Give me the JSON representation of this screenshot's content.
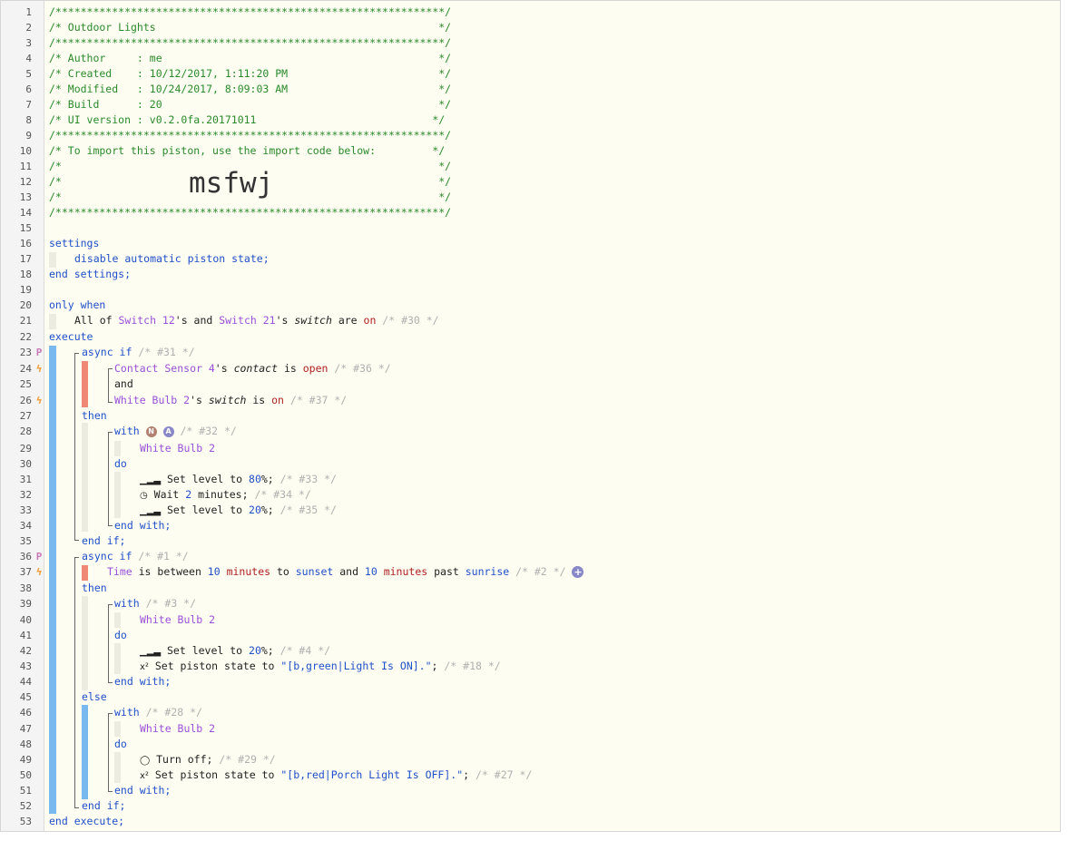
{
  "header": {
    "stars": "/**************************************************************/",
    "title": "/* Outdoor Lights                                             */",
    "author": "/* Author     : me                                            */",
    "created": "/* Created    : 10/12/2017, 1:11:20 PM                        */",
    "modified": "/* Modified   : 10/24/2017, 8:09:03 AM                        */",
    "build": "/* Build      : 20                                            */",
    "ui_version": "/* UI version : v0.2.0fa.20171011                            */",
    "import_line": "/* To import this piston, use the import code below:         */",
    "blank": "/*                                                            */",
    "import_code": "msfwj"
  },
  "settings": {
    "open": "settings",
    "line": "disable automatic piston state;",
    "close": "end settings;"
  },
  "only_when": {
    "label": "only when",
    "all_of": "All of ",
    "dev1": "Switch 12",
    "mid": "'s and ",
    "dev2": "Switch 21",
    "poss": "'s ",
    "attr": "switch",
    "are": " are ",
    "val": "on",
    "comment": " /* #30 */"
  },
  "execute": {
    "open": "execute",
    "close": "end execute;"
  },
  "if1": {
    "kw": "async if",
    "comment": " /* #31 */",
    "c1_dev": "Contact Sensor 4",
    "c1_poss": "'s ",
    "c1_attr": "contact",
    "c1_is": " is ",
    "c1_val": "open",
    "c1_comment": " /* #36 */",
    "and": "and",
    "c2_dev": "White Bulb 2",
    "c2_poss": "'s ",
    "c2_attr": "switch",
    "c2_is": " is ",
    "c2_val": "on",
    "c2_comment": " /* #37 */",
    "then": "then",
    "with": "with",
    "badge_n": "N",
    "badge_a": "A",
    "with_comment": " /* #32 */",
    "device": "White Bulb 2",
    "do": "do",
    "a1_pre": " Set level to ",
    "a1_val": "80",
    "a1_post": "%;",
    "a1_comment": " /* #33 */",
    "a2_pre": " Wait ",
    "a2_val": "2",
    "a2_post": " minutes;",
    "a2_comment": " /* #34 */",
    "a3_pre": " Set level to ",
    "a3_val": "20",
    "a3_post": "%;",
    "a3_comment": " /* #35 */",
    "end_with": "end with;",
    "end_if": "end if;"
  },
  "if2": {
    "kw": "async if",
    "comment": " /* #1 */",
    "c_time": "Time",
    "c_is": " is between ",
    "c_n1": "10",
    "c_min1": " minutes",
    "c_to": " to ",
    "c_sunset": "sunset",
    "c_and": " and ",
    "c_n2": "10",
    "c_min2": " minutes",
    "c_past": " past ",
    "c_sunrise": "sunrise",
    "c_comment": " /* #2 */",
    "then": "then",
    "with": "with",
    "with_comment": " /* #3 */",
    "device": "White Bulb 2",
    "do": "do",
    "a1_pre": " Set level to ",
    "a1_val": "20",
    "a1_post": "%;",
    "a1_comment": " /* #4 */",
    "a2_pre": " Set piston state to ",
    "a2_val": "\"[b,green|Light Is ON].\"",
    "a2_post": ";",
    "a2_comment": " /* #18 */",
    "end_with": "end with;",
    "else": "else",
    "with2": "with",
    "with2_comment": " /* #28 */",
    "device2": "White Bulb 2",
    "do2": "do",
    "b1": " Turn off;",
    "b1_comment": " /* #29 */",
    "b2_pre": " Set piston state to ",
    "b2_val": "\"[b,red|Porch Light Is OFF].\"",
    "b2_post": ";",
    "b2_comment": " /* #27 */",
    "end_with2": "end with;",
    "end_if": "end if;"
  },
  "line_numbers": [
    "1",
    "2",
    "3",
    "4",
    "5",
    "6",
    "7",
    "8",
    "9",
    "10",
    "11",
    "12",
    "13",
    "14",
    "15",
    "16",
    "17",
    "18",
    "19",
    "20",
    "21",
    "22",
    "23",
    "24",
    "25",
    "26",
    "27",
    "28",
    "29",
    "30",
    "31",
    "32",
    "33",
    "34",
    "35",
    "36",
    "37",
    "38",
    "39",
    "40",
    "41",
    "42",
    "43",
    "44",
    "45",
    "46",
    "47",
    "48",
    "49",
    "50",
    "51",
    "52",
    "53"
  ],
  "icons": {
    "level": "signal-bars-icon",
    "wait": "clock-icon",
    "piston_state": "superscript-x-icon",
    "turn_off": "power-icon",
    "add": "plus-icon",
    "restriction": "p-icon",
    "trigger": "lightning-icon"
  },
  "colors": {
    "comment": "#2a8a2a",
    "keyword": "#2050c8",
    "device": "#9a50d8",
    "value": "#b02020",
    "bar_blue": "#7ab8f0",
    "bar_pink": "#f08878"
  }
}
